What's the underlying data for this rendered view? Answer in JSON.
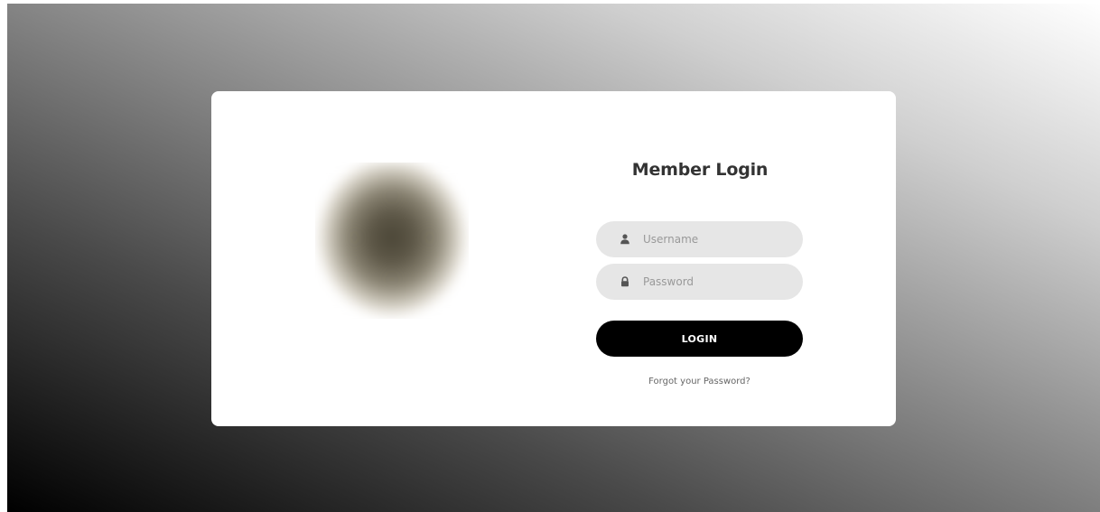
{
  "login": {
    "title": "Member Login",
    "username_placeholder": "Username",
    "password_placeholder": "Password",
    "login_label": "LOGIN",
    "forgot_label": "Forgot your Password?"
  },
  "icons": {
    "username": "user-icon",
    "password": "lock-icon"
  },
  "colors": {
    "card_background": "#ffffff",
    "field_background": "#e6e6e6",
    "button_background": "#000000",
    "button_text": "#ffffff",
    "title_text": "#333333"
  }
}
